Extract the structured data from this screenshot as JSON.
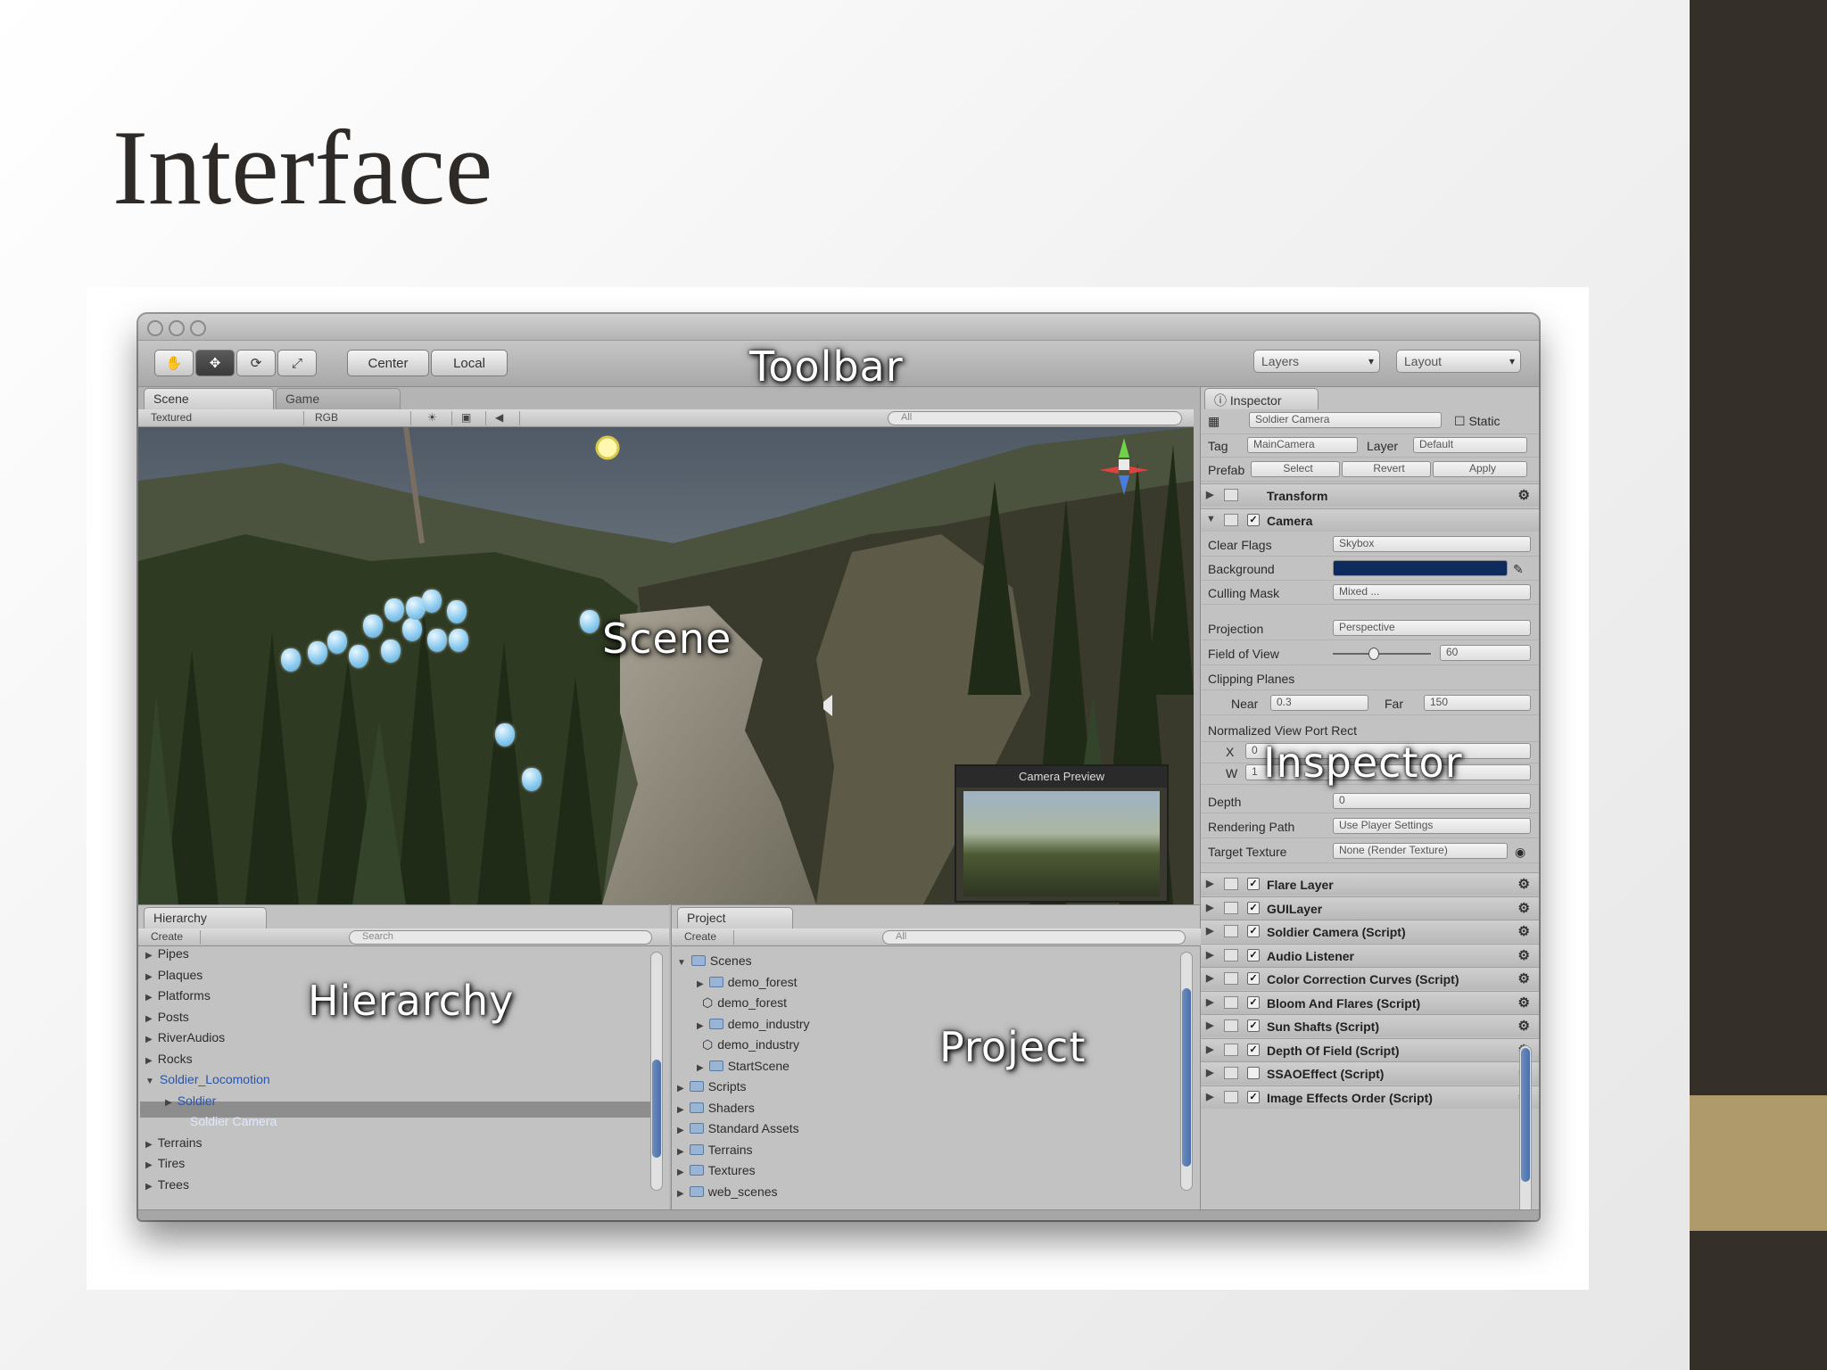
{
  "slide": {
    "title": "Interface",
    "colors": {
      "side_bar": "#352f2a",
      "accent": "#ae9a6a"
    }
  },
  "overlays": {
    "toolbar": "Toolbar",
    "scene": "Scene",
    "inspector": "Inspector",
    "hierarchy": "Hierarchy",
    "project": "Project"
  },
  "toolbar": {
    "tools": [
      "hand-icon",
      "move-icon",
      "rotate-icon",
      "scale-icon"
    ],
    "pivot_center": "Center",
    "pivot_local": "Local",
    "layers": "Layers",
    "layout": "Layout"
  },
  "scene_panel": {
    "tabs": [
      "Scene",
      "Game"
    ],
    "render_mode": "Textured",
    "color_mode": "RGB",
    "search_placeholder": "All"
  },
  "camera_preview": {
    "title": "Camera Preview"
  },
  "inspector": {
    "tab": "Inspector",
    "object_name": "Soldier Camera",
    "static_label": "Static",
    "tag_label": "Tag",
    "tag_value": "MainCamera",
    "layer_label": "Layer",
    "layer_value": "Default",
    "prefab_label": "Prefab",
    "prefab_buttons": [
      "Select",
      "Revert",
      "Apply"
    ],
    "transform": "Transform",
    "camera": "Camera",
    "fields": {
      "clear_flags": {
        "label": "Clear Flags",
        "value": "Skybox"
      },
      "background": {
        "label": "Background",
        "color": "#0f2a5c"
      },
      "culling_mask": {
        "label": "Culling Mask",
        "value": "Mixed ..."
      },
      "projection": {
        "label": "Projection",
        "value": "Perspective"
      },
      "fov": {
        "label": "Field of View",
        "value": "60"
      },
      "clipping": {
        "label": "Clipping Planes"
      },
      "near": {
        "label": "Near",
        "value": "0.3"
      },
      "far": {
        "label": "Far",
        "value": "150"
      },
      "viewport": {
        "label": "Normalized View Port Rect"
      },
      "x": {
        "label": "X",
        "value": "0"
      },
      "w": {
        "label": "W",
        "value": "1"
      },
      "depth": {
        "label": "Depth",
        "value": "0"
      },
      "rendering_path": {
        "label": "Rendering Path",
        "value": "Use Player Settings"
      },
      "target_texture": {
        "label": "Target Texture",
        "value": "None (Render Texture)"
      }
    },
    "components": [
      "Flare Layer",
      "GUILayer",
      "Soldier Camera (Script)",
      "Audio Listener",
      "Color Correction Curves (Script)",
      "Bloom And Flares (Script)",
      "Sun Shafts (Script)",
      "Depth Of Field (Script)",
      "SSAOEffect (Script)",
      "Image Effects Order (Script)"
    ]
  },
  "hierarchy": {
    "tab": "Hierarchy",
    "create": "Create",
    "search_placeholder": "Search",
    "items": [
      "Pipes",
      "Plaques",
      "Platforms",
      "Posts",
      "RiverAudios",
      "Rocks",
      "Soldier_Locomotion",
      "Soldier",
      "Soldier Camera",
      "Terrains",
      "Tires",
      "Trees"
    ]
  },
  "project": {
    "tab": "Project",
    "create": "Create",
    "search_placeholder": "All",
    "items": [
      "Scenes",
      "demo_forest",
      "demo_forest",
      "demo_industry",
      "demo_industry",
      "StartScene",
      "Scripts",
      "Shaders",
      "Standard Assets",
      "Terrains",
      "Textures",
      "web_scenes"
    ]
  }
}
